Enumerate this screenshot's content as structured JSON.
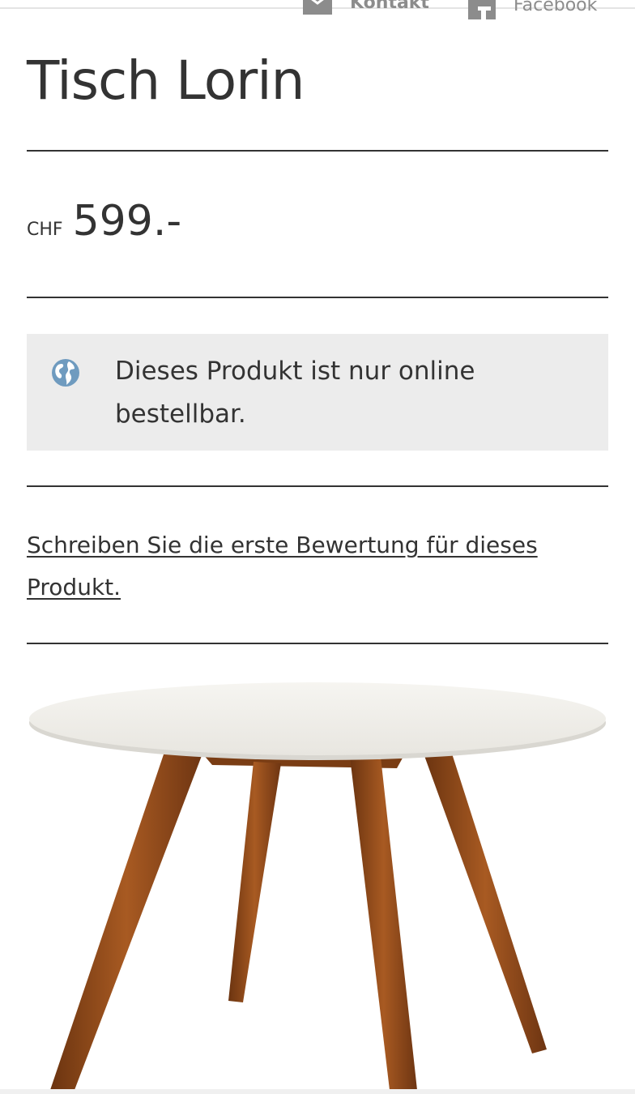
{
  "header": {
    "contact_label": "Kontakt",
    "facebook_label": "Facebook"
  },
  "product": {
    "title": "Tisch Lorin",
    "currency": "CHF",
    "price": "599.-",
    "notice_icon": "globe-icon",
    "availability_notice": "Dieses Produkt ist nur online bestellbar.",
    "review_link": "Schreiben Sie die erste Bewertung für dieses Produkt.",
    "image_alt": "Tisch Lorin"
  },
  "colors": {
    "text": "#333333",
    "notice_background": "#ececec",
    "globe_icon": "#6f9bbf",
    "wood": "#8b4a1c",
    "tabletop": "#f4f3ef"
  }
}
